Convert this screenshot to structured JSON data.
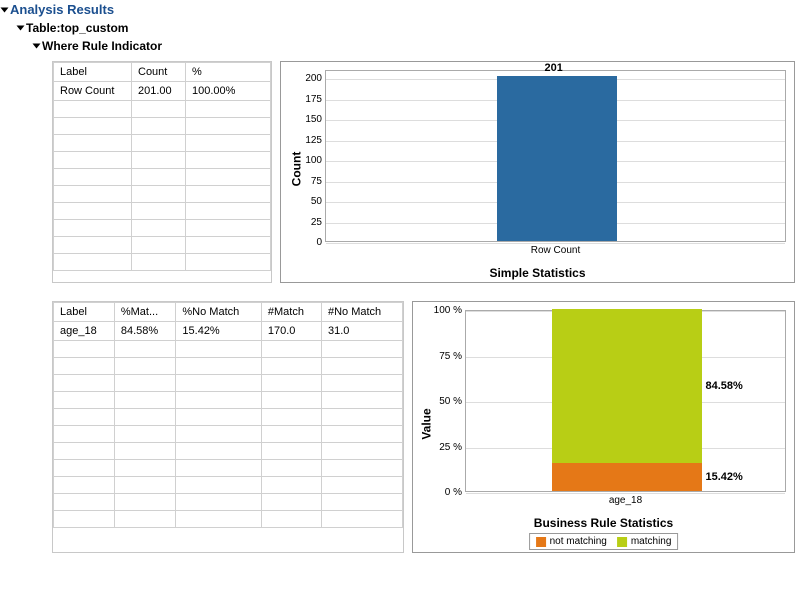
{
  "header": {
    "analysis_results": "Analysis Results",
    "table_label": "Table:top_custom",
    "rule_label": "Where Rule Indicator"
  },
  "table1": {
    "headers": [
      "Label",
      "Count",
      "%"
    ],
    "rows": [
      {
        "label": "Row Count",
        "count": "201.00",
        "pct": "100.00%"
      }
    ]
  },
  "table2": {
    "headers": [
      "Label",
      "%Mat...",
      "%No Match",
      "#Match",
      "#No Match"
    ],
    "rows": [
      {
        "label": "age_18",
        "pct_match": "84.58%",
        "pct_no": "15.42%",
        "n_match": "170.0",
        "n_no": "31.0"
      }
    ]
  },
  "chart1": {
    "ylabel": "Count",
    "title": "Simple Statistics",
    "ticks": [
      "0",
      "25",
      "50",
      "75",
      "100",
      "125",
      "150",
      "175",
      "200"
    ],
    "cat": "Row Count",
    "value_label": "201"
  },
  "chart2": {
    "ylabel": "Value",
    "title": "Business Rule Statistics",
    "ticks": [
      "0 %",
      "25 %",
      "50 %",
      "75 %",
      "100 %"
    ],
    "cat": "age_18",
    "match_label": "84.58%",
    "nomatch_label": "15.42%",
    "legend_no": "not matching",
    "legend_yes": "matching"
  },
  "chart_data": [
    {
      "type": "bar",
      "title": "Simple Statistics",
      "ylabel": "Count",
      "categories": [
        "Row Count"
      ],
      "values": [
        201
      ],
      "ylim": [
        0,
        210
      ]
    },
    {
      "type": "bar",
      "title": "Business Rule Statistics",
      "ylabel": "Value",
      "categories": [
        "age_18"
      ],
      "series": [
        {
          "name": "not matching",
          "values": [
            15.42
          ],
          "color": "#e57817"
        },
        {
          "name": "matching",
          "values": [
            84.58
          ],
          "color": "#b8ce15"
        }
      ],
      "ylim": [
        0,
        100
      ],
      "units": "%",
      "stacked": true
    }
  ]
}
